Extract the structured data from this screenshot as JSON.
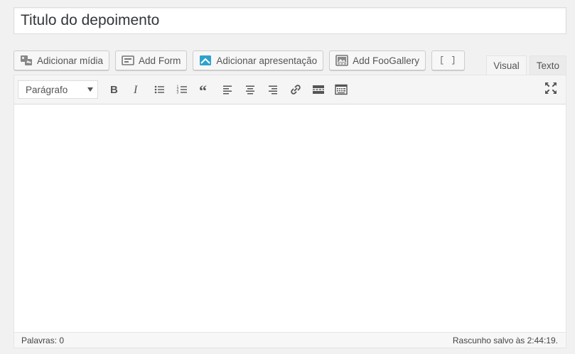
{
  "title": {
    "value": "Titulo do depoimento"
  },
  "media_buttons": [
    {
      "label": "Adicionar mídia",
      "icon": "add-media-icon"
    },
    {
      "label": "Add Form",
      "icon": "form-icon"
    },
    {
      "label": "Adicionar apresentação",
      "icon": "presentation-icon"
    },
    {
      "label": "Add FooGallery",
      "icon": "gallery-icon"
    },
    {
      "label": "[ ]",
      "icon": "shortcode-icon"
    }
  ],
  "tabs": {
    "visual": "Visual",
    "text": "Texto",
    "active": "visual"
  },
  "toolbar": {
    "format_value": "Parágrafo",
    "buttons": [
      "bold-icon",
      "italic-icon",
      "bullet-list-icon",
      "numbered-list-icon",
      "blockquote-icon",
      "align-left-icon",
      "align-center-icon",
      "align-right-icon",
      "link-icon",
      "read-more-icon",
      "toolbar-toggle-icon"
    ],
    "fullscreen_icon": "fullscreen-icon"
  },
  "status": {
    "word_count": "Palavras: 0",
    "draft_saved": "Rascunho salvo às 2:44:19."
  },
  "colors": {
    "background": "#f1f1f1",
    "toolbar": "#f5f5f5",
    "link_icon": "#555555",
    "presentation_icon": "#2ea2cc"
  }
}
